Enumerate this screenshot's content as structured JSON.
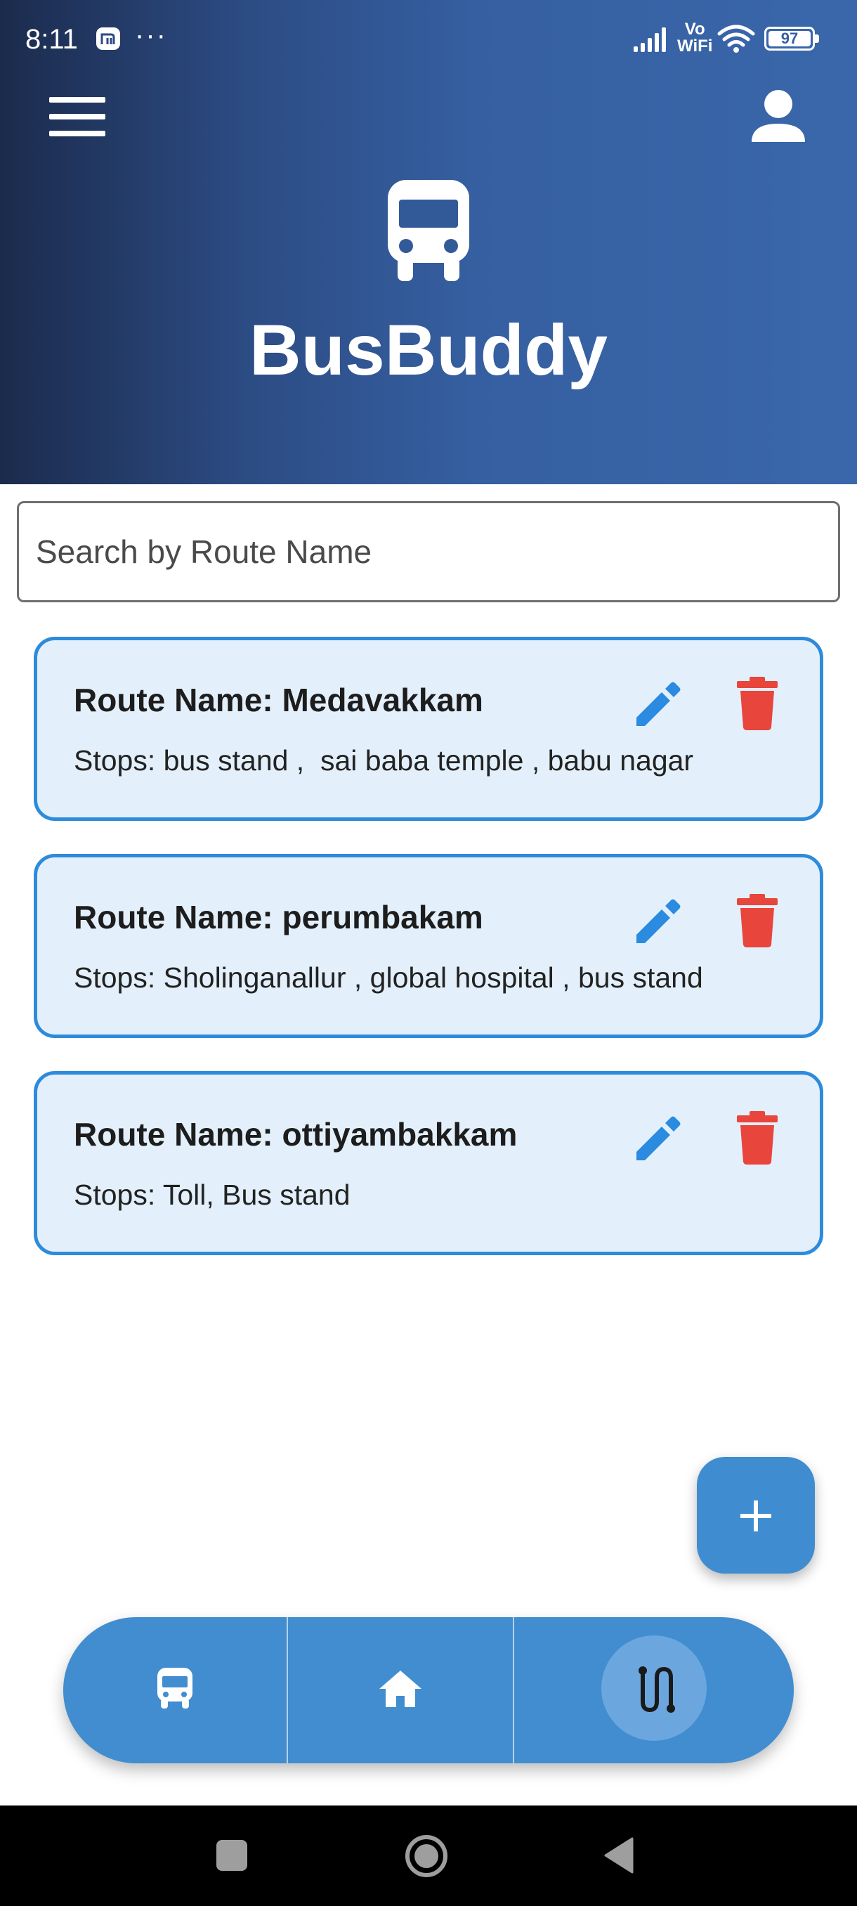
{
  "status_bar": {
    "time": "8:11",
    "notification_icon": "mi-icon",
    "more_indicator": "···",
    "network_label": "Vo\nWiFi",
    "network_label_top": "Vo",
    "network_label_bottom": "WiFi",
    "battery_level": "97"
  },
  "header": {
    "app_title": "BusBuddy",
    "menu_icon": "hamburger-menu-icon",
    "profile_icon": "person-icon",
    "logo_icon": "bus-icon",
    "gradient_start": "#1b2b4c",
    "gradient_end": "#3a67ab"
  },
  "search": {
    "placeholder": "Search by Route Name",
    "value": ""
  },
  "routes": [
    {
      "name_label": "Route Name: Medavakkam",
      "stops_label": "Stops: bus stand ,  sai baba temple , babu nagar"
    },
    {
      "name_label": "Route Name: perumbakam",
      "stops_label": "Stops: Sholinganallur , global hospital , bus stand"
    },
    {
      "name_label": "Route Name: ottiyambakkam",
      "stops_label": "Stops: Toll, Bus stand"
    }
  ],
  "route_actions": {
    "edit_icon": "pencil-icon",
    "delete_icon": "trash-icon"
  },
  "fab": {
    "icon": "plus-icon"
  },
  "bottom_nav": {
    "items": [
      {
        "icon": "bus-icon",
        "active": false
      },
      {
        "icon": "home-icon",
        "active": false
      },
      {
        "icon": "route-icon",
        "active": true
      }
    ]
  },
  "system_nav": {
    "items": [
      "recents-square-icon",
      "home-circle-icon",
      "back-triangle-icon"
    ]
  },
  "colors": {
    "card_background": "#e3f0fb",
    "card_border": "#2e8bdb",
    "edit_icon": "#2a8be0",
    "delete_icon": "#e8453c",
    "nav_background": "#418dd0",
    "fab_background": "#3f8dd0"
  }
}
